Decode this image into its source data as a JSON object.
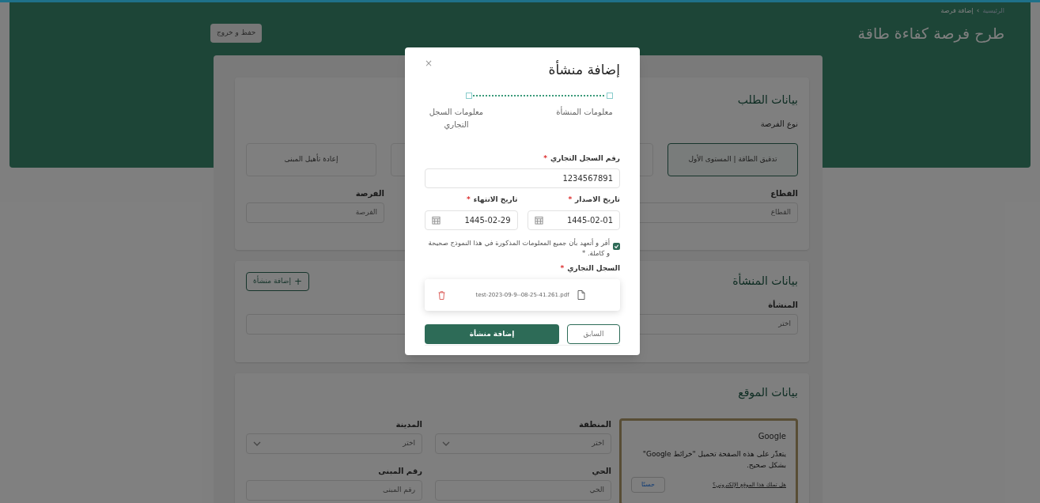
{
  "breadcrumb": [
    {
      "label": "الرئيسية",
      "selected": false
    },
    {
      "label": "إضافة فرصة",
      "selected": true
    }
  ],
  "breadcrumb_separator": "›",
  "page_title": "طرح فرصة كفاءة طاقة",
  "save_exit_button": "حفظ و خروج",
  "request_section": {
    "title": "بيانات الطلب",
    "type_label": "نوع الفرصة",
    "options": [
      {
        "label": "تدقيق الطاقة | المستوى الأول",
        "selected": true
      },
      {
        "selected": false
      },
      {
        "label": "إعادة تأهيل المبنى",
        "selected": false
      }
    ],
    "fields": [
      {
        "label": "القطاع",
        "placeholder": "القطاع"
      },
      {
        "label": "الفرصة",
        "placeholder": "الفرصة"
      }
    ]
  },
  "facility_section": {
    "title": "بيانات المنشأة",
    "add_button": "إضافة منشأة",
    "add_icon": "+",
    "field": {
      "label": "المنشأة",
      "placeholder": "اختر"
    }
  },
  "location_section": {
    "title": "بيانات الموقع",
    "map_error": {
      "brand": "Google",
      "message": "يتعذّر على هذه الصفحة تحميل \"خرائط Google\" بشكل صحيح.",
      "link": "هل تملك هذا الموقع الإلكتروني؟",
      "button": "حسنًا"
    },
    "fields": [
      {
        "kind": "select",
        "label": "المنطقة",
        "placeholder": "اختر"
      },
      {
        "kind": "select",
        "label": "المدينة",
        "placeholder": "اختر"
      },
      {
        "kind": "input",
        "label": "الحي",
        "placeholder": "الحي"
      },
      {
        "kind": "input",
        "label": "رقم المبنى",
        "placeholder": "رقم المبنى"
      }
    ]
  },
  "modal": {
    "title": "إضافة منشأة",
    "close": "×",
    "steps": [
      {
        "label": "معلومات المنشأة"
      },
      {
        "label": "معلومات السجل التجاري"
      }
    ],
    "cr_number": {
      "label": "رقم السجل التجاري",
      "required_mark": "*",
      "value": "1234567891"
    },
    "dates": [
      {
        "label": "تاريخ الاصدار",
        "required_mark": "*",
        "value": "1445-02-01"
      },
      {
        "label": "تاريخ الانتهاء",
        "required_mark": "*",
        "value": "1445-02-29"
      }
    ],
    "declaration": {
      "text": "أقر و أتعهد بأن جميع المعلومات المذكورة في هذا النموذج صحيحة و كاملة. *",
      "checked": true
    },
    "attachment": {
      "label": "السجل التجاري",
      "required_mark": "*",
      "file_name": "test-2023-09-9--08-25-41.261.pdf"
    },
    "buttons": [
      {
        "kind": "secondary",
        "label": "السابق"
      },
      {
        "kind": "primary",
        "label": "إضافة منشأة"
      }
    ]
  }
}
